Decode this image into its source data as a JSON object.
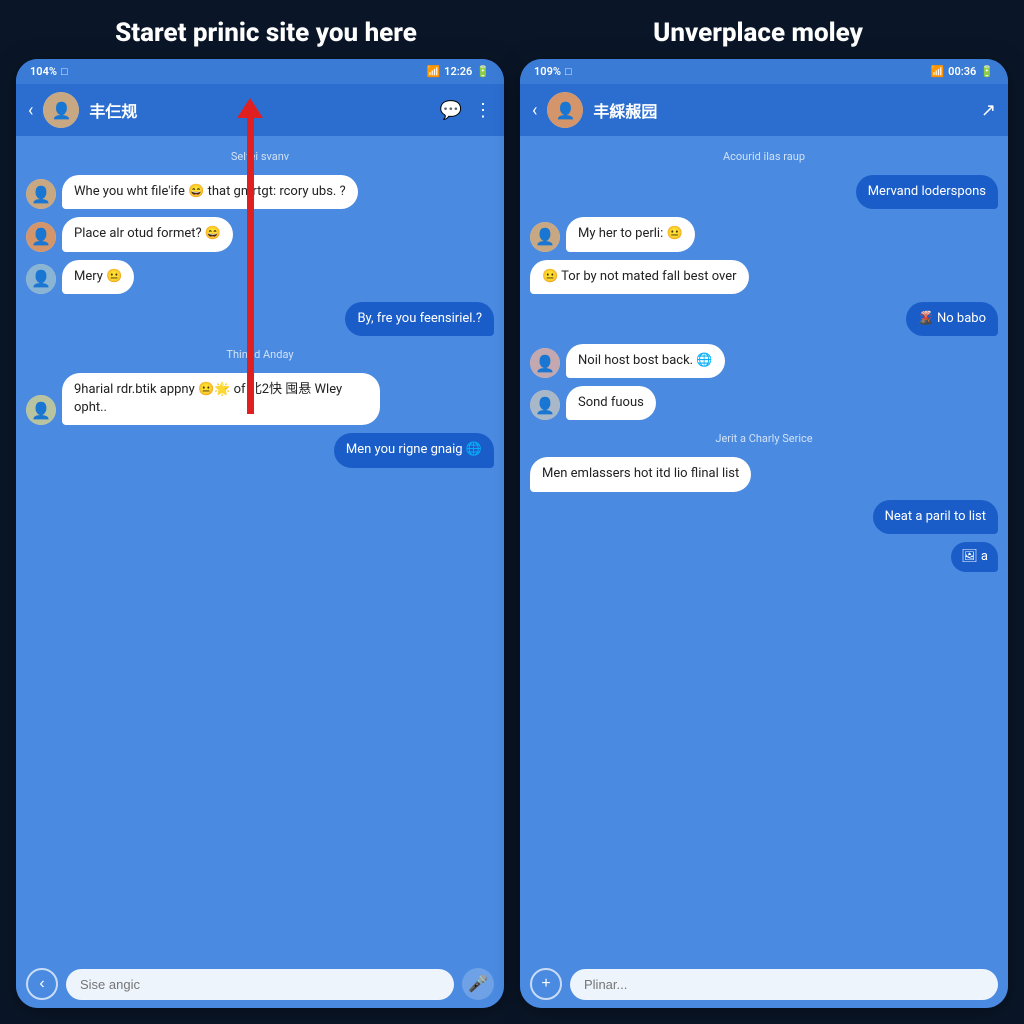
{
  "page": {
    "left_title": "Staret prinic site you here",
    "right_title": "Unverplace moley"
  },
  "left_phone": {
    "status_bar": {
      "left": "104%",
      "time": "12:26",
      "battery": "▮"
    },
    "nav": {
      "title": "丰仨规",
      "icon1": "💬",
      "icon2": "⋮"
    },
    "date_label_1": "Selfei  svanv",
    "messages": [
      {
        "type": "received",
        "avatar": "av1",
        "text": "Whe you wht file'ife 😄 that gnrrtgt: rcory ubs. ?"
      },
      {
        "type": "received",
        "avatar": "av2",
        "text": "Place alr otud formet? 😄"
      },
      {
        "type": "received",
        "avatar": "av3",
        "text": "Mery 😐"
      },
      {
        "type": "sent",
        "text": "By, fre you feensiriel.?"
      }
    ],
    "date_label_2": "Thinod Anday",
    "messages2": [
      {
        "type": "received",
        "avatar": "av4",
        "text": "9harial rdr.btik appny 😐🌟 of 北2快 囤悬 Wley opht.."
      },
      {
        "type": "sent",
        "text": "Men you rigne gnaig 🌐"
      }
    ],
    "input_placeholder": "Sise angic"
  },
  "right_phone": {
    "status_bar": {
      "left": "109%",
      "time": "00:36",
      "battery": "▮"
    },
    "nav": {
      "title": "丰綵赧园",
      "icon1": "↗"
    },
    "date_label_1": "Acourid ilas raup",
    "messages": [
      {
        "type": "sent",
        "text": "Mervand loderspons"
      },
      {
        "type": "received",
        "avatar": "av1",
        "text": "My her to perli: 😐"
      },
      {
        "type": "none",
        "text": "😐 Tor by not mated fall best over"
      },
      {
        "type": "sent",
        "text": "🌋 No babo"
      },
      {
        "type": "received",
        "avatar": "av5",
        "text": "Noil host bost back. 🌐"
      },
      {
        "type": "received",
        "avatar": "av6",
        "text": "Sond fuous"
      }
    ],
    "date_label_2": "Jerit a Charly Serice",
    "messages2": [
      {
        "type": "none",
        "text": "Men emlassers hot itd lio flinal list"
      },
      {
        "type": "sent",
        "text": "Neat a paril to list"
      },
      {
        "type": "sent_icon",
        "text": "🖼 a"
      }
    ],
    "input_placeholder": "Plinar..."
  }
}
